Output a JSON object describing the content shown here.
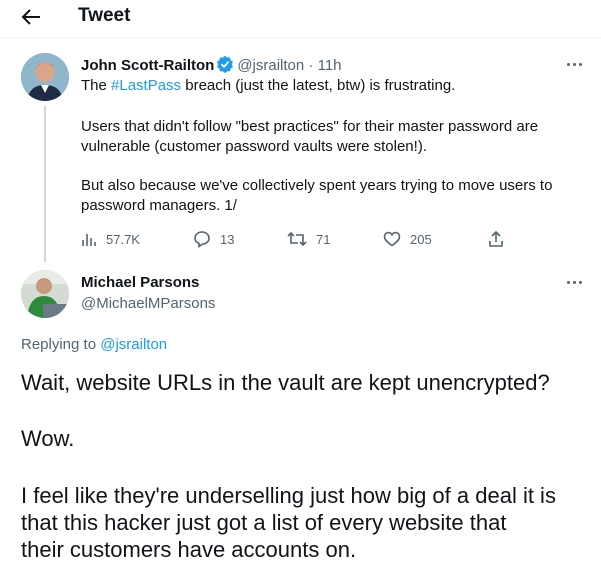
{
  "header": {
    "title": "Tweet",
    "back_icon": "arrow-left-icon"
  },
  "tweet": {
    "author_name": "John Scott-Railton",
    "author_handle": "@jsrailton",
    "separator": "·",
    "time": "11h",
    "verified_icon": "verified-badge-icon",
    "text_line1_prefix": "The ",
    "hashtag": "#LastPass",
    "text_line1_suffix": " breach (just the latest, btw) is frustrating.",
    "text_line2": "Users that didn't follow \"best practices\" for their master password are",
    "text_line3": "vulnerable (customer password vaults were stolen!).",
    "text_line4": "But also because we've collectively spent years trying to move users to",
    "text_line5": "password managers. 1/",
    "views": "57.7K",
    "replies": "13",
    "retweets": "71",
    "likes": "205"
  },
  "reply": {
    "author_name": "Michael Parsons",
    "author_handle": "@MichaelMParsons",
    "replying_prefix": "Replying to ",
    "replying_handle": "@jsrailton",
    "line1": "Wait, website URLs in the vault are kept unencrypted?",
    "line2": "Wow.",
    "line3": "I feel like they're underselling just how big of a deal it is",
    "line4": "that this hacker just got a list of every website that",
    "line5": "their customers have accounts on."
  },
  "colors": {
    "accent": "#1d9bf0",
    "secondary_text": "#536471",
    "primary_text": "#0f1419",
    "divider": "#eff3f4"
  }
}
